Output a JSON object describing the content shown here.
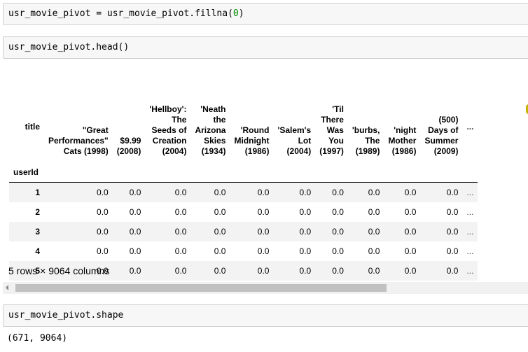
{
  "cells": {
    "fillna_code": {
      "prefix": "usr_movie_pivot = usr_movie_pivot.fillna(",
      "arg": "0",
      "suffix": ")"
    },
    "head_code": "usr_movie_pivot.head()",
    "shape_code": "usr_movie_pivot.shape",
    "shape_output": "(671, 9064)"
  },
  "table": {
    "columns_label": "title",
    "index_label": "userId",
    "columns": [
      [
        "\"Great",
        "Performances\"",
        "Cats (1998)"
      ],
      [
        "$9.99",
        "(2008)"
      ],
      [
        "'Hellboy':",
        "The",
        "Seeds of",
        "Creation",
        "(2004)"
      ],
      [
        "'Neath",
        "the",
        "Arizona",
        "Skies",
        "(1934)"
      ],
      [
        "'Round",
        "Midnight",
        "(1986)"
      ],
      [
        "'Salem's",
        "Lot",
        "(2004)"
      ],
      [
        "'Til",
        "There",
        "Was",
        "You",
        "(1997)"
      ],
      [
        "'burbs,",
        "The",
        "(1989)"
      ],
      [
        "'night",
        "Mother",
        "(1986)"
      ],
      [
        "(500)",
        "Days of",
        "Summer",
        "(2009)"
      ]
    ],
    "ellipsis": "...",
    "rows": [
      {
        "index": "1",
        "values": [
          "0.0",
          "0.0",
          "0.0",
          "0.0",
          "0.0",
          "0.0",
          "0.0",
          "0.0",
          "0.0",
          "0.0"
        ]
      },
      {
        "index": "2",
        "values": [
          "0.0",
          "0.0",
          "0.0",
          "0.0",
          "0.0",
          "0.0",
          "0.0",
          "0.0",
          "0.0",
          "0.0"
        ]
      },
      {
        "index": "3",
        "values": [
          "0.0",
          "0.0",
          "0.0",
          "0.0",
          "0.0",
          "0.0",
          "0.0",
          "0.0",
          "0.0",
          "0.0"
        ]
      },
      {
        "index": "4",
        "values": [
          "0.0",
          "0.0",
          "0.0",
          "0.0",
          "0.0",
          "0.0",
          "0.0",
          "0.0",
          "0.0",
          "0.0"
        ]
      },
      {
        "index": "5",
        "values": [
          "0.0",
          "0.0",
          "0.0",
          "0.0",
          "0.0",
          "0.0",
          "0.0",
          "0.0",
          "0.0",
          "0.0"
        ]
      }
    ],
    "shape_summary": "5 rows × 9064 columns"
  },
  "icons": {
    "scroll_left": "triangle-left-icon"
  }
}
